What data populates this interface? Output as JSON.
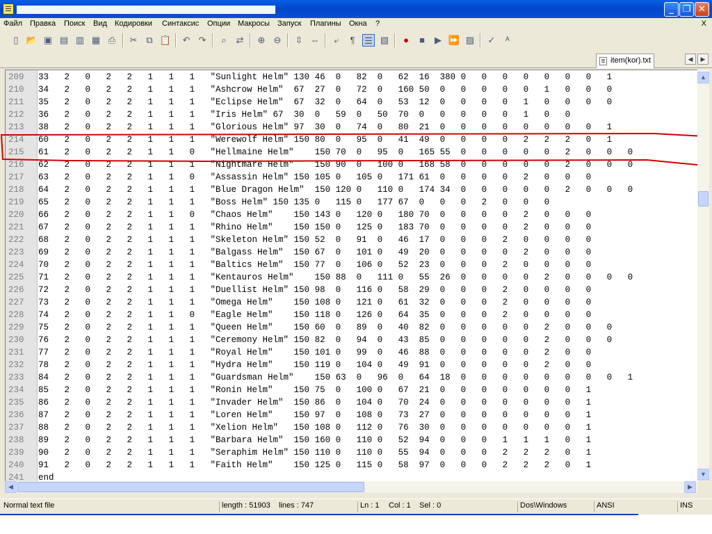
{
  "window": {
    "minimize_icon": "minimize-icon",
    "maximize_icon": "restore-icon",
    "close_icon": "close-icon",
    "min_glyph": "_",
    "max_glyph": "❐",
    "close_glyph": "✕"
  },
  "menu": [
    "Файл",
    "Правка",
    "Поиск",
    "Вид",
    "Кодировки",
    "Синтаксис",
    "Опции",
    "Макросы",
    "Запуск",
    "Плагины",
    "Окна",
    "?"
  ],
  "menu_close": "X",
  "toolbar": [
    {
      "name": "new-file-icon",
      "glyph": "▯"
    },
    {
      "name": "open-file-icon",
      "glyph": "📂"
    },
    {
      "name": "save-icon",
      "glyph": "▣"
    },
    {
      "name": "save-all-icon",
      "glyph": "▤"
    },
    {
      "name": "close-file-icon",
      "glyph": "▥"
    },
    {
      "name": "close-all-icon",
      "glyph": "▦"
    },
    {
      "name": "print-icon",
      "glyph": "⎙"
    },
    {
      "name": "cut-icon",
      "glyph": "✂"
    },
    {
      "name": "copy-icon",
      "glyph": "⧉"
    },
    {
      "name": "paste-icon",
      "glyph": "📋"
    },
    {
      "name": "undo-icon",
      "glyph": "↶"
    },
    {
      "name": "redo-icon",
      "glyph": "↷"
    },
    {
      "name": "find-icon",
      "glyph": "⌕"
    },
    {
      "name": "replace-icon",
      "glyph": "⇄"
    },
    {
      "name": "zoom-in-icon",
      "glyph": "⊕"
    },
    {
      "name": "zoom-out-icon",
      "glyph": "⊖"
    },
    {
      "name": "sync-vertical-icon",
      "glyph": "⇳"
    },
    {
      "name": "sync-horizontal-icon",
      "glyph": "⇔"
    },
    {
      "name": "word-wrap-icon",
      "glyph": "⤶"
    },
    {
      "name": "show-all-chars-icon",
      "glyph": "¶"
    },
    {
      "name": "indent-guide-icon",
      "glyph": "☰"
    },
    {
      "name": "user-lang-icon",
      "glyph": "▧"
    },
    {
      "name": "record-macro-icon",
      "glyph": "●"
    },
    {
      "name": "stop-macro-icon",
      "glyph": "■"
    },
    {
      "name": "play-macro-icon",
      "glyph": "▶"
    },
    {
      "name": "play-multiple-macro-icon",
      "glyph": "⏩"
    },
    {
      "name": "save-macro-icon",
      "glyph": "▨"
    },
    {
      "name": "spell-check-icon",
      "glyph": "✓"
    },
    {
      "name": "abc-check-icon",
      "glyph": "ᴬ"
    }
  ],
  "tab": {
    "label": "item(kor).txt",
    "icon": "document-icon"
  },
  "tab_nav": {
    "left": "◀",
    "right": "▶"
  },
  "editor": {
    "lines": [
      {
        "n": "209",
        "text": "33   2   0   2   2   1   1   1   \"Sunlight Helm\" 130 46  0   82  0   62  16  380 0   0   0   0   0   0   0   1"
      },
      {
        "n": "210",
        "text": "34   2   0   2   2   1   1   1   \"Ashcrow Helm\"  67  27  0   72  0   160 50  0   0   0   0   0   1   0   0   0"
      },
      {
        "n": "211",
        "text": "35   2   0   2   2   1   1   1   \"Eclipse Helm\"  67  32  0   64  0   53  12  0   0   0   0   1   0   0   0   0"
      },
      {
        "n": "212",
        "text": "36   2   0   2   2   1   1   1   \"Iris Helm\" 67  30  0   59  0   50  70  0   0   0   0   0   1   0   0"
      },
      {
        "n": "213",
        "text": "38   2   0   2   2   1   1   1   \"Glorious Helm\" 97  30  0   74  0   80  21  0   0   0   0   0   0   0   0   1"
      },
      {
        "n": "214",
        "text": "60   2   0   2   2   1   1   1   \"Werewolf Helm\" 150 80  0   95  0   41  49  0   0   0   0   2   2   2   0   1"
      },
      {
        "n": "215",
        "text": "61   2   0   2   2   1   1   0   \"Hellmaine Helm\"    150 70  0   95  0   165 55  0   0   0   0   0   2   0   0   0"
      },
      {
        "n": "216",
        "text": "62   2   0   2   2   1   1   1   \"Nightmare Helm\"    150 90  0   100 0   168 58  0   0   0   0   0   2   0   0   0"
      },
      {
        "n": "217",
        "text": "63   2   0   2   2   1   1   0   \"Assassin Helm\" 150 105 0   105 0   171 61  0   0   0   0   2   0   0   0"
      },
      {
        "n": "218",
        "text": "64   2   0   2   2   1   1   1   \"Blue Dragon Helm\"  150 120 0   110 0   174 34  0   0   0   0   0   2   0   0   0"
      },
      {
        "n": "219",
        "text": "65   2   0   2   2   1   1   1   \"Boss Helm\" 150 135 0   115 0   177 67  0   0   0   2   0   0   0"
      },
      {
        "n": "220",
        "text": "66   2   0   2   2   1   1   0   \"Chaos Helm\"    150 143 0   120 0   180 70  0   0   0   0   2   0   0   0"
      },
      {
        "n": "221",
        "text": "67   2   0   2   2   1   1   1   \"Rhino Helm\"    150 150 0   125 0   183 70  0   0   0   0   2   0   0   0"
      },
      {
        "n": "222",
        "text": "68   2   0   2   2   1   1   1   \"Skeleton Helm\" 150 52  0   91  0   46  17  0   0   0   2   0   0   0   0"
      },
      {
        "n": "223",
        "text": "69   2   0   2   2   1   1   1   \"Balgass Helm\"  150 67  0   101 0   49  20  0   0   0   0   2   0   0   0"
      },
      {
        "n": "224",
        "text": "70   2   0   2   2   1   1   1   \"Baltics Helm\"  150 77  0   106 0   52  23  0   0   0   2   0   0   0   0"
      },
      {
        "n": "225",
        "text": "71   2   0   2   2   1   1   1   \"Kentauros Helm\"    150 88  0   111 0   55  26  0   0   0   0   2   0   0   0   0"
      },
      {
        "n": "226",
        "text": "72   2   0   2   2   1   1   1   \"Duellist Helm\" 150 98  0   116 0   58  29  0   0   0   2   0   0   0   0"
      },
      {
        "n": "227",
        "text": "73   2   0   2   2   1   1   1   \"Omega Helm\"    150 108 0   121 0   61  32  0   0   0   2   0   0   0   0"
      },
      {
        "n": "228",
        "text": "74   2   0   2   2   1   1   0   \"Eagle Helm\"    150 118 0   126 0   64  35  0   0   0   2   0   0   0   0"
      },
      {
        "n": "229",
        "text": "75   2   0   2   2   1   1   1   \"Queen Helm\"    150 60  0   89  0   40  82  0   0   0   0   0   2   0   0   0"
      },
      {
        "n": "230",
        "text": "76   2   0   2   2   1   1   1   \"Ceremony Helm\" 150 82  0   94  0   43  85  0   0   0   0   0   2   0   0   0"
      },
      {
        "n": "231",
        "text": "77   2   0   2   2   1   1   1   \"Royal Helm\"    150 101 0   99  0   46  88  0   0   0   0   0   2   0   0"
      },
      {
        "n": "232",
        "text": "78   2   0   2   2   1   1   1   \"Hydra Helm\"    150 119 0   104 0   49  91  0   0   0   0   0   2   0   0"
      },
      {
        "n": "233",
        "text": "84   2   0   2   2   1   1   1   \"Guardsman Helm\"    150 63  0   96  0   64  18  0   0   0   0   0   0   0   0   1"
      },
      {
        "n": "234",
        "text": "85   2   0   2   2   1   1   1   \"Ronin Helm\"    150 75  0   100 0   67  21  0   0   0   0   0   0   0   1"
      },
      {
        "n": "235",
        "text": "86   2   0   2   2   1   1   1   \"Invader Helm\"  150 86  0   104 0   70  24  0   0   0   0   0   0   0   1"
      },
      {
        "n": "236",
        "text": "87   2   0   2   2   1   1   1   \"Loren Helm\"    150 97  0   108 0   73  27  0   0   0   0   0   0   0   1"
      },
      {
        "n": "237",
        "text": "88   2   0   2   2   1   1   1   \"Xelion Helm\"   150 108 0   112 0   76  30  0   0   0   0   0   0   0   1"
      },
      {
        "n": "238",
        "text": "89   2   0   2   2   1   1   1   \"Barbara Helm\"  150 160 0   110 0   52  94  0   0   0   1   1   1   0   1"
      },
      {
        "n": "239",
        "text": "90   2   0   2   2   1   1   1   \"Seraphim Helm\" 150 110 0   110 0   55  94  0   0   0   2   2   2   0   1"
      },
      {
        "n": "240",
        "text": "91   2   0   2   2   1   1   1   \"Faith Helm\"    150 125 0   115 0   58  97  0   0   0   2   2   2   0   1"
      },
      {
        "n": "241",
        "text": "end"
      }
    ]
  },
  "scroll": {
    "up": "▲",
    "down": "▼",
    "left": "◀",
    "right": "▶"
  },
  "status": {
    "filetype": "Normal text file",
    "length": "length : 51903",
    "lines": "lines : 747",
    "ln": "Ln : 1",
    "col": "Col : 1",
    "sel": "Sel : 0",
    "eol": "Dos\\Windows",
    "encoding": "ANSI",
    "mode": "INS"
  },
  "highlight_color": "#d40000"
}
